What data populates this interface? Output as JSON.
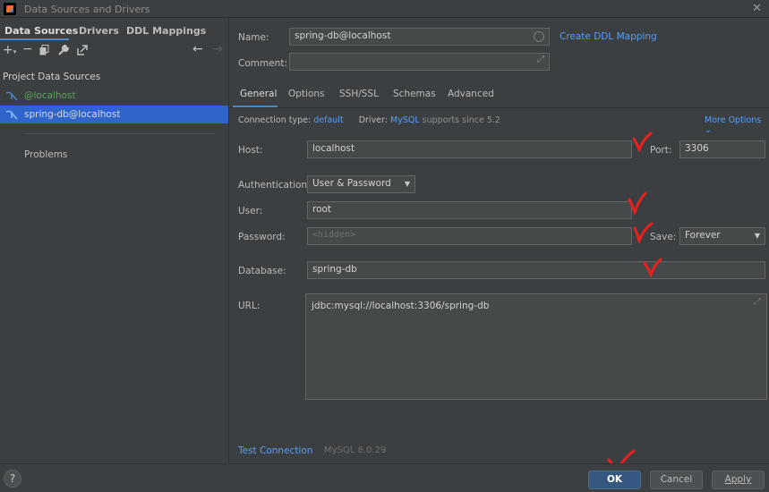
{
  "window": {
    "title": "Data Sources and Drivers"
  },
  "left": {
    "tabs": [
      "Data Sources",
      "Drivers",
      "DDL Mappings"
    ],
    "toolbar_icons": [
      "add-icon",
      "remove-icon",
      "duplicate-icon",
      "wrench-icon",
      "navigate-icon"
    ],
    "back": "←",
    "forward": "→",
    "section_title": "Project Data Sources",
    "items": [
      {
        "label": "@localhost",
        "color": "#5aa55a"
      },
      {
        "label": "spring-db@localhost",
        "color": "#dcdcdc"
      }
    ],
    "problems": "Problems"
  },
  "form": {
    "name_label": "Name:",
    "name_value": "spring-db@localhost",
    "create_ddl": "Create DDL Mapping",
    "comment_label": "Comment:",
    "comment_value": "",
    "tabs": [
      "General",
      "Options",
      "SSH/SSL",
      "Schemas",
      "Advanced"
    ],
    "conn_type_label": "Connection type:",
    "conn_type_value": "default",
    "driver_label": "Driver:",
    "driver_value": "MySQL",
    "driver_note": "supports since 5.2",
    "more_options": "More Options",
    "host_label": "Host:",
    "host_value": "localhost",
    "port_label": "Port:",
    "port_value": "3306",
    "auth_label": "Authentication:",
    "auth_value": "User & Password",
    "user_label": "User:",
    "user_value": "root",
    "password_label": "Password:",
    "password_placeholder": "<hidden>",
    "save_label": "Save:",
    "save_value": "Forever",
    "database_label": "Database:",
    "database_value": "spring-db",
    "url_label": "URL:",
    "url_value": "jdbc:mysql://localhost:3306/spring-db",
    "test_connection": "Test Connection",
    "driver_version": "MySQL 8.0.29"
  },
  "footer": {
    "help": "?",
    "ok": "OK",
    "cancel": "Cancel",
    "apply": "Apply"
  },
  "accent": "#2f65ca",
  "annotation_color": "#e8201e"
}
